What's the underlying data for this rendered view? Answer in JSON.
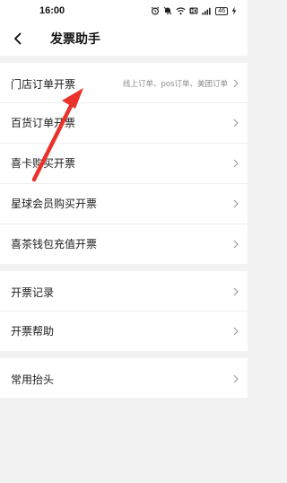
{
  "status_bar": {
    "time": "16:00",
    "battery": "46",
    "icons": [
      "alarm-icon",
      "mute-icon",
      "wifi-icon",
      "hd-icon",
      "signal-icon",
      "battery-icon",
      "charging-icon"
    ]
  },
  "header": {
    "title": "发票助手",
    "back_icon": "chevron-left-icon"
  },
  "groups": [
    {
      "items": [
        {
          "label": "门店订单开票",
          "hint": "线上订单、pos订单、美团订单"
        },
        {
          "label": "百货订单开票",
          "hint": ""
        },
        {
          "label": "喜卡购买开票",
          "hint": ""
        },
        {
          "label": "星球会员购买开票",
          "hint": ""
        },
        {
          "label": "喜茶钱包充值开票",
          "hint": ""
        }
      ]
    },
    {
      "items": [
        {
          "label": "开票记录",
          "hint": ""
        },
        {
          "label": "开票帮助",
          "hint": ""
        }
      ]
    },
    {
      "items": [
        {
          "label": "常用抬头",
          "hint": ""
        }
      ]
    }
  ],
  "annotation": {
    "arrow_color": "#e8322b"
  },
  "colors": {
    "background": "#f2f2f2",
    "card": "#ffffff",
    "hint": "#8a8a8a"
  }
}
